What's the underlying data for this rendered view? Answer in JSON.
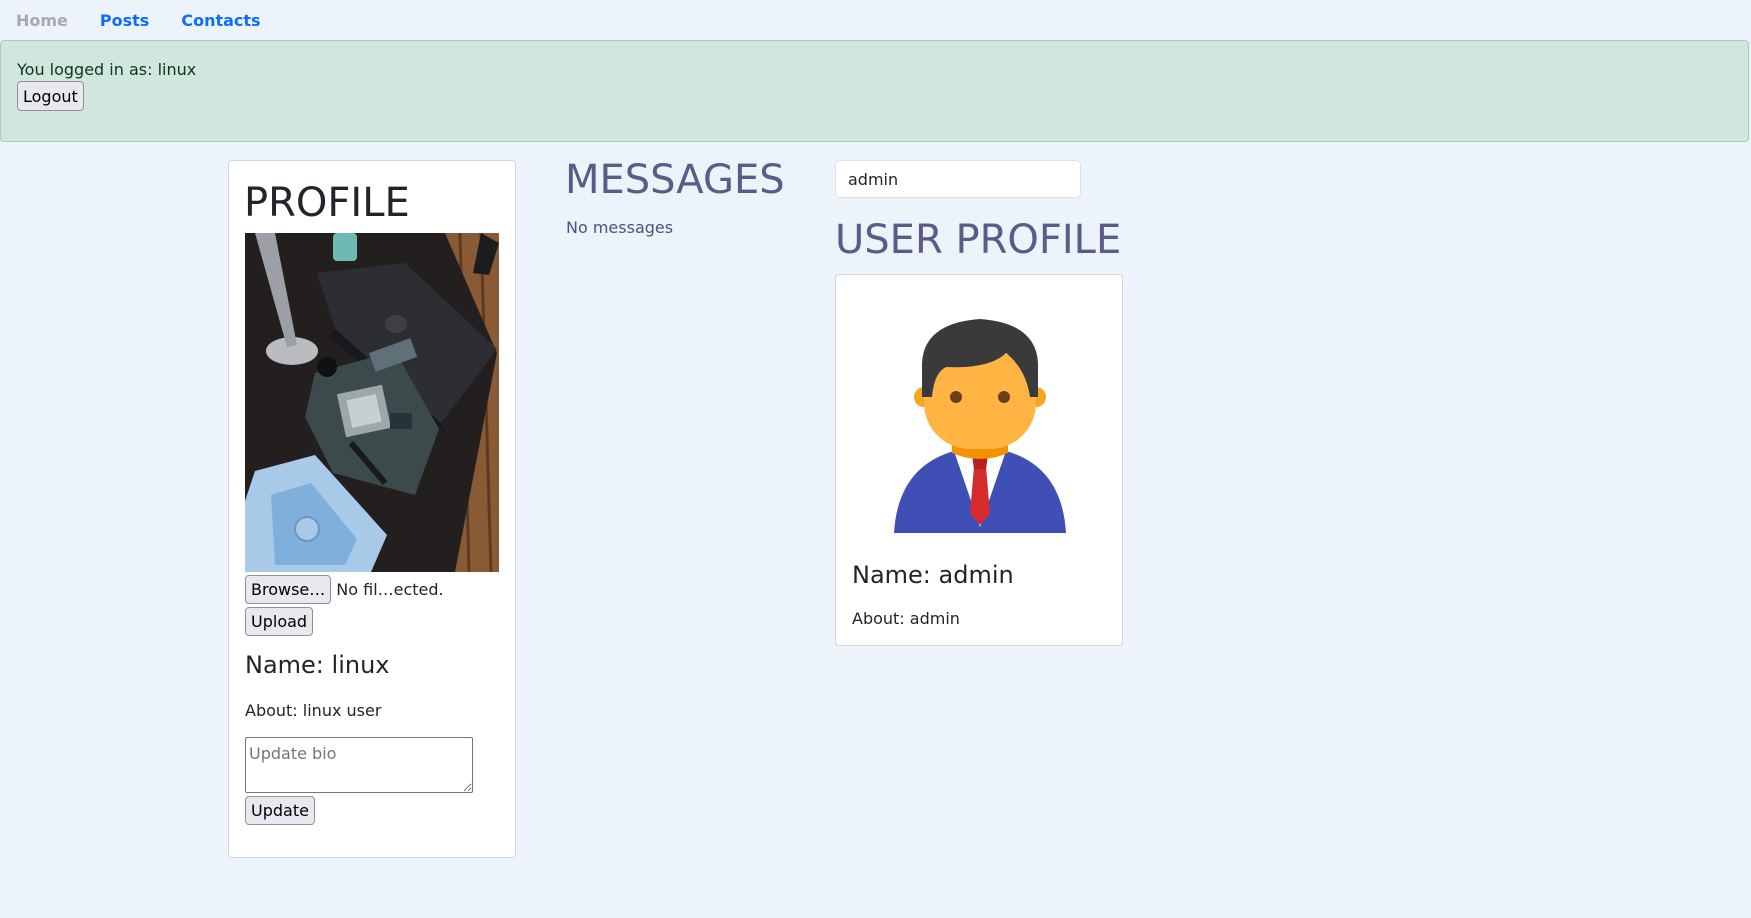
{
  "nav": {
    "home": "Home",
    "posts": "Posts",
    "contacts": "Contacts"
  },
  "alert": {
    "logged_in_text": "You logged in as: linux",
    "logout_label": "Logout"
  },
  "profile": {
    "title": "PROFILE",
    "browse_label": "Browse…",
    "file_status": "No fil…ected.",
    "upload_label": "Upload",
    "name": "Name: linux",
    "about": "About: linux user",
    "bio_placeholder": "Update bio",
    "update_label": "Update"
  },
  "messages": {
    "title": "MESSAGES",
    "empty_text": "No messages"
  },
  "user_search": {
    "value": "admin"
  },
  "user_profile": {
    "title": "USER PROFILE",
    "name": "Name: admin",
    "about": "About: admin"
  },
  "colors": {
    "page_background": "#edf3fa",
    "nav_link": "#0d6efd",
    "nav_link_active": "#a6aab0",
    "alert_background": "#d1e7dd",
    "heading_accent": "#5a5b87"
  }
}
